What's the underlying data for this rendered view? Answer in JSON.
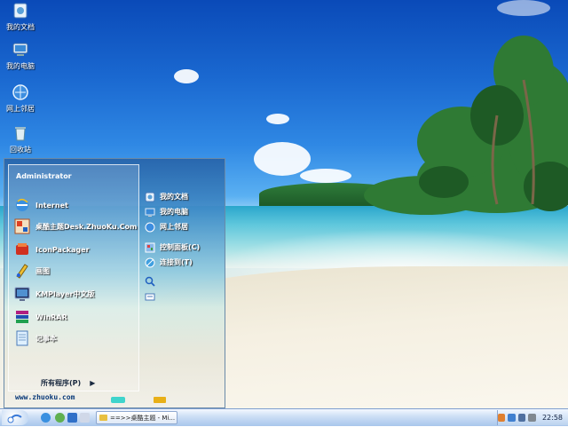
{
  "desktop": {
    "icons": [
      {
        "label": "我的文档",
        "icon": "my-documents-icon"
      },
      {
        "label": "我的电脑",
        "icon": "my-computer-icon"
      },
      {
        "label": "网上邻居",
        "icon": "network-places-icon"
      },
      {
        "label": "回收站",
        "icon": "recycle-bin-icon"
      }
    ]
  },
  "start_menu": {
    "user": "Administrator",
    "pinned": [
      {
        "label": "Internet",
        "icon": "internet-explorer-icon"
      },
      {
        "label": "桌酷主题Desk.ZhuoKu.Com",
        "icon": "zhuoku-theme-icon"
      },
      {
        "label": "IconPackager",
        "icon": "iconpackager-icon"
      },
      {
        "label": "画图",
        "icon": "paint-icon"
      },
      {
        "label": "KMPlayer中文版",
        "icon": "kmplayer-icon"
      },
      {
        "label": "WinRAR",
        "icon": "winrar-icon"
      },
      {
        "label": "记事本",
        "icon": "notepad-icon"
      }
    ],
    "all_programs": "所有程序(P)",
    "right_items": [
      {
        "label": "我的文档",
        "icon": "my-documents-icon"
      },
      {
        "label": "我的电脑",
        "icon": "my-computer-icon"
      },
      {
        "label": "网上邻居",
        "icon": "network-places-icon"
      },
      {
        "label": "控制面板(C)",
        "icon": "control-panel-icon"
      },
      {
        "label": "连接到(T)",
        "icon": "connect-to-icon"
      },
      {
        "label": "",
        "icon": "search-icon"
      },
      {
        "label": "",
        "icon": "run-icon"
      }
    ],
    "footer_url": "www.zhuoku.com"
  },
  "taskbar": {
    "task_label": "==>>桌酷主题 - Mi...",
    "clock": "22:58"
  },
  "colors": {
    "accent_teal": "#3fd4cc",
    "accent_yellow": "#e8b018"
  }
}
